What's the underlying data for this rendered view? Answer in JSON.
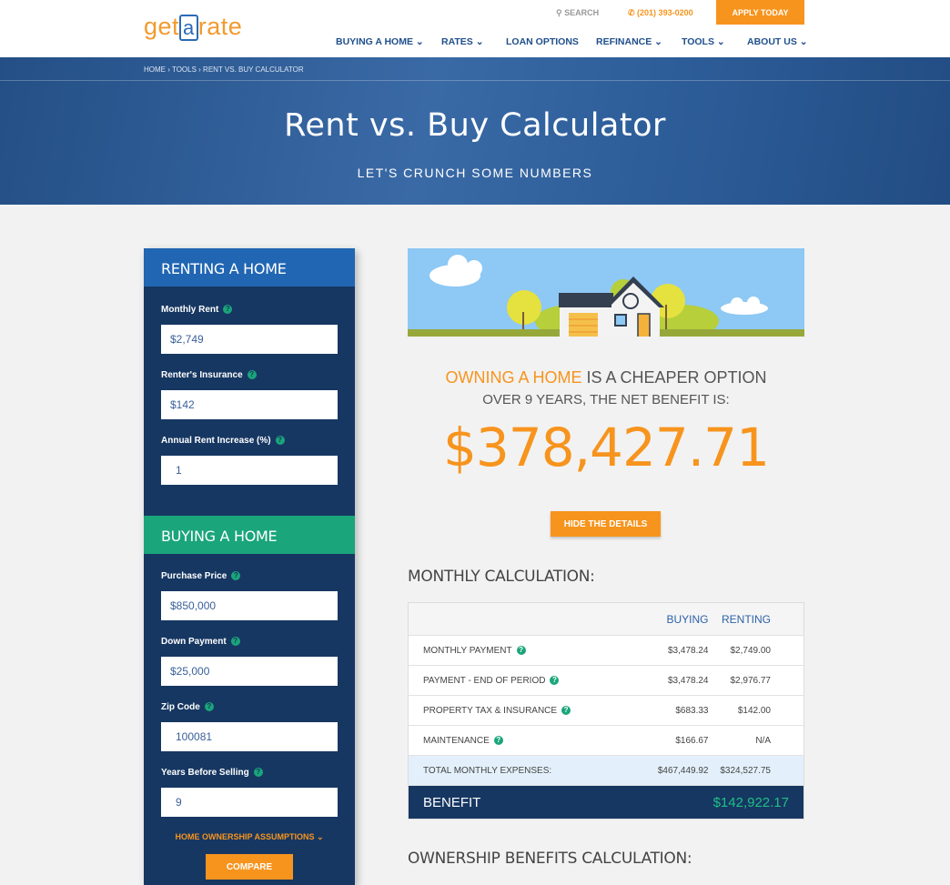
{
  "header": {
    "logo": "getarate",
    "search": "SEARCH",
    "phone": "(201) 393-0200",
    "apply": "APPLY TODAY",
    "nav": [
      "BUYING A HOME",
      "RATES",
      "LOAN OPTIONS",
      "REFINANCE",
      "TOOLS",
      "ABOUT US"
    ]
  },
  "hero": {
    "breadcrumb": "HOME › TOOLS › RENT VS. BUY CALCULATOR",
    "title": "Rent vs. Buy Calculator",
    "subtitle": "LET'S CRUNCH SOME NUMBERS"
  },
  "renting": {
    "title": "RENTING A HOME",
    "fields": [
      {
        "label": "Monthly Rent",
        "value": "$2,749"
      },
      {
        "label": "Renter's Insurance",
        "value": "$142"
      },
      {
        "label": "Annual Rent Increase (%)",
        "value": "1"
      }
    ]
  },
  "buying": {
    "title": "BUYING A HOME",
    "fields": [
      {
        "label": "Purchase Price",
        "value": "$850,000"
      },
      {
        "label": "Down Payment",
        "value": "$25,000"
      },
      {
        "label": "Zip Code",
        "value": "100081"
      },
      {
        "label": "Years Before Selling",
        "value": "9"
      }
    ]
  },
  "assumptions": "HOME OWNERSHIP ASSUMPTIONS ⌄",
  "compare": "COMPARE",
  "result": {
    "highlight": "OWNING A HOME",
    "rest": " IS A CHEAPER OPTION",
    "line2": "OVER 9 YEARS, THE NET BENEFIT IS:",
    "amount": "$378,427.71",
    "hide": "HIDE THE DETAILS"
  },
  "monthly": {
    "title": "MONTHLY CALCULATION:",
    "cols": [
      "BUYING",
      "RENTING"
    ],
    "rows": [
      {
        "label": "MONTHLY PAYMENT",
        "buy": "$3,478.24",
        "rent": "$2,749.00"
      },
      {
        "label": "PAYMENT - END OF PERIOD",
        "buy": "$3,478.24",
        "rent": "$2,976.77"
      },
      {
        "label": "PROPERTY TAX & INSURANCE",
        "buy": "$683.33",
        "rent": "$142.00"
      },
      {
        "label": "MAINTENANCE",
        "buy": "$166.67",
        "rent": "N/A"
      }
    ],
    "total": {
      "label": "TOTAL MONTHLY EXPENSES:",
      "buy": "$467,449.92",
      "rent": "$324,527.75"
    },
    "benefit": {
      "label": "BENEFIT",
      "value": "$142,922.17"
    }
  },
  "ownership_title": "OWNERSHIP BENEFITS CALCULATION:",
  "colors": {
    "orange": "#f7941d",
    "navy": "#163762",
    "blue": "#2166b3",
    "green": "#1aa57a"
  }
}
